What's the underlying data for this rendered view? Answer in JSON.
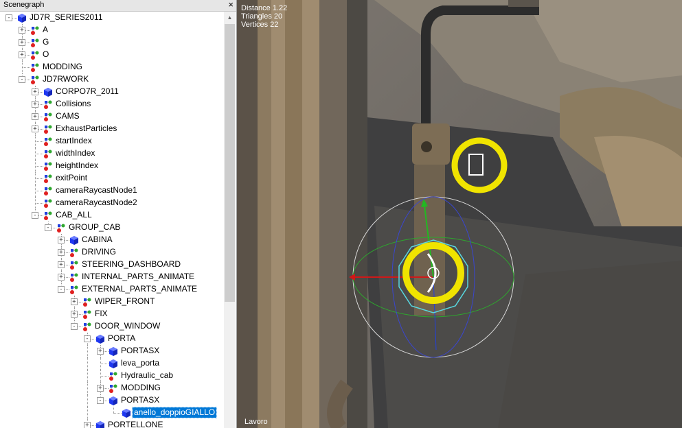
{
  "panel": {
    "title": "Scenegraph",
    "close": "×"
  },
  "tree": [
    {
      "label": "JD7R_SERIES2011",
      "depth": 0,
      "exp": "-",
      "icon": "cube"
    },
    {
      "label": "A",
      "depth": 1,
      "exp": "+",
      "icon": "node"
    },
    {
      "label": "G",
      "depth": 1,
      "exp": "+",
      "icon": "node"
    },
    {
      "label": "O",
      "depth": 1,
      "exp": "+",
      "icon": "node"
    },
    {
      "label": "MODDING",
      "depth": 1,
      "exp": "",
      "icon": "node"
    },
    {
      "label": "JD7RWORK",
      "depth": 1,
      "exp": "-",
      "icon": "node"
    },
    {
      "label": "CORPO7R_2011",
      "depth": 2,
      "exp": "+",
      "icon": "cube"
    },
    {
      "label": "Collisions",
      "depth": 2,
      "exp": "+",
      "icon": "node"
    },
    {
      "label": "CAMS",
      "depth": 2,
      "exp": "+",
      "icon": "node"
    },
    {
      "label": "ExhaustParticles",
      "depth": 2,
      "exp": "+",
      "icon": "node"
    },
    {
      "label": "startIndex",
      "depth": 2,
      "exp": "",
      "icon": "node"
    },
    {
      "label": "widthIndex",
      "depth": 2,
      "exp": "",
      "icon": "node"
    },
    {
      "label": "heightIndex",
      "depth": 2,
      "exp": "",
      "icon": "node"
    },
    {
      "label": "exitPoint",
      "depth": 2,
      "exp": "",
      "icon": "node"
    },
    {
      "label": "cameraRaycastNode1",
      "depth": 2,
      "exp": "",
      "icon": "node"
    },
    {
      "label": "cameraRaycastNode2",
      "depth": 2,
      "exp": "",
      "icon": "node"
    },
    {
      "label": "CAB_ALL",
      "depth": 2,
      "exp": "-",
      "icon": "node"
    },
    {
      "label": "GROUP_CAB",
      "depth": 3,
      "exp": "-",
      "icon": "node"
    },
    {
      "label": "CABINA",
      "depth": 4,
      "exp": "+",
      "icon": "cube"
    },
    {
      "label": "DRIVING",
      "depth": 4,
      "exp": "+",
      "icon": "node"
    },
    {
      "label": "STEERING_DASHBOARD",
      "depth": 4,
      "exp": "+",
      "icon": "node"
    },
    {
      "label": "INTERNAL_PARTS_ANIMATE",
      "depth": 4,
      "exp": "+",
      "icon": "node"
    },
    {
      "label": "EXTERNAL_PARTS_ANIMATE",
      "depth": 4,
      "exp": "-",
      "icon": "node"
    },
    {
      "label": "WIPER_FRONT",
      "depth": 5,
      "exp": "+",
      "icon": "node"
    },
    {
      "label": "FIX",
      "depth": 5,
      "exp": "+",
      "icon": "node"
    },
    {
      "label": "DOOR_WINDOW",
      "depth": 5,
      "exp": "-",
      "icon": "node"
    },
    {
      "label": "PORTA",
      "depth": 6,
      "exp": "-",
      "icon": "cube"
    },
    {
      "label": "PORTASX",
      "depth": 7,
      "exp": "+",
      "icon": "cube"
    },
    {
      "label": "leva_porta",
      "depth": 7,
      "exp": "",
      "icon": "cube"
    },
    {
      "label": "Hydraulic_cab",
      "depth": 7,
      "exp": "",
      "icon": "node"
    },
    {
      "label": "MODDING",
      "depth": 7,
      "exp": "+",
      "icon": "node"
    },
    {
      "label": "PORTASX",
      "depth": 7,
      "exp": "-",
      "icon": "cube"
    },
    {
      "label": "anello_doppioGIALLO",
      "depth": 8,
      "exp": "",
      "icon": "cube",
      "selected": true
    },
    {
      "label": "PORTELLONE",
      "depth": 6,
      "exp": "+",
      "icon": "cube"
    }
  ],
  "viewport": {
    "stats": [
      "Distance 1.22",
      "Triangles 20",
      "Vertices 22"
    ],
    "mode": "Lavoro"
  },
  "colors": {
    "cube": "#1e37f0",
    "node_red": "#e02020",
    "node_green": "#2fa82f",
    "node_blue": "#2040e0",
    "selection": "#0078d7",
    "ring": "#f0e400"
  }
}
